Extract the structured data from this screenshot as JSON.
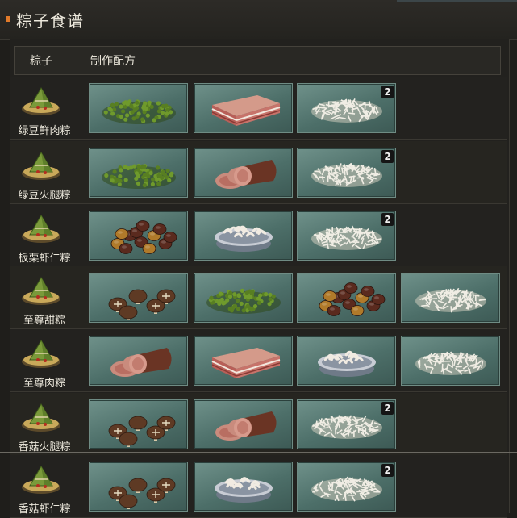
{
  "header": {
    "title": "粽子食谱"
  },
  "columns": {
    "zongzi": "粽子",
    "recipe": "制作配方"
  },
  "rows": [
    {
      "name": "绿豆鲜肉粽",
      "ingredients": [
        {
          "type": "mungbean"
        },
        {
          "type": "pork"
        },
        {
          "type": "rice",
          "count": "2"
        }
      ]
    },
    {
      "name": "绿豆火腿粽",
      "ingredients": [
        {
          "type": "mungbean"
        },
        {
          "type": "ham"
        },
        {
          "type": "rice",
          "count": "2"
        }
      ]
    },
    {
      "name": "板栗虾仁粽",
      "ingredients": [
        {
          "type": "chestnut"
        },
        {
          "type": "shrimp"
        },
        {
          "type": "rice",
          "count": "2"
        }
      ]
    },
    {
      "name": "至尊甜粽",
      "ingredients": [
        {
          "type": "mushroom"
        },
        {
          "type": "mungbean"
        },
        {
          "type": "chestnut"
        },
        {
          "type": "rice"
        }
      ]
    },
    {
      "name": "至尊肉粽",
      "ingredients": [
        {
          "type": "ham"
        },
        {
          "type": "pork"
        },
        {
          "type": "shrimp"
        },
        {
          "type": "rice"
        }
      ]
    },
    {
      "name": "香菇火腿粽",
      "ingredients": [
        {
          "type": "mushroom"
        },
        {
          "type": "ham"
        },
        {
          "type": "rice",
          "count": "2"
        }
      ]
    },
    {
      "name": "香菇虾仁粽",
      "ingredients": [
        {
          "type": "mushroom"
        },
        {
          "type": "shrimp"
        },
        {
          "type": "rice",
          "count": "2"
        }
      ]
    }
  ],
  "colors": {
    "accent": "#e07a2a",
    "cell": "#5e807a",
    "text": "#ece8dc"
  }
}
